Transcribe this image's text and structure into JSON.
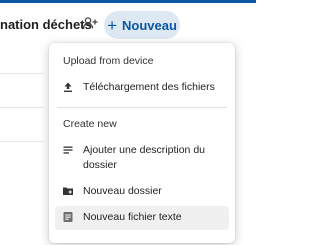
{
  "header": {
    "title_partial": "nation déchets",
    "new_button_label": "Nouveau",
    "accent": "#0b57a3"
  },
  "menu": {
    "upload_section": {
      "heading": "Upload from device",
      "items": [
        {
          "label": "Téléchargement des fichiers",
          "icon": "upload-icon"
        }
      ]
    },
    "create_section": {
      "heading": "Create new",
      "items": [
        {
          "label": "Ajouter une description du dossier",
          "icon": "text-lines-icon"
        },
        {
          "label": "Nouveau dossier",
          "icon": "new-folder-icon"
        },
        {
          "label": "Nouveau fichier texte",
          "icon": "text-file-icon"
        }
      ]
    }
  }
}
